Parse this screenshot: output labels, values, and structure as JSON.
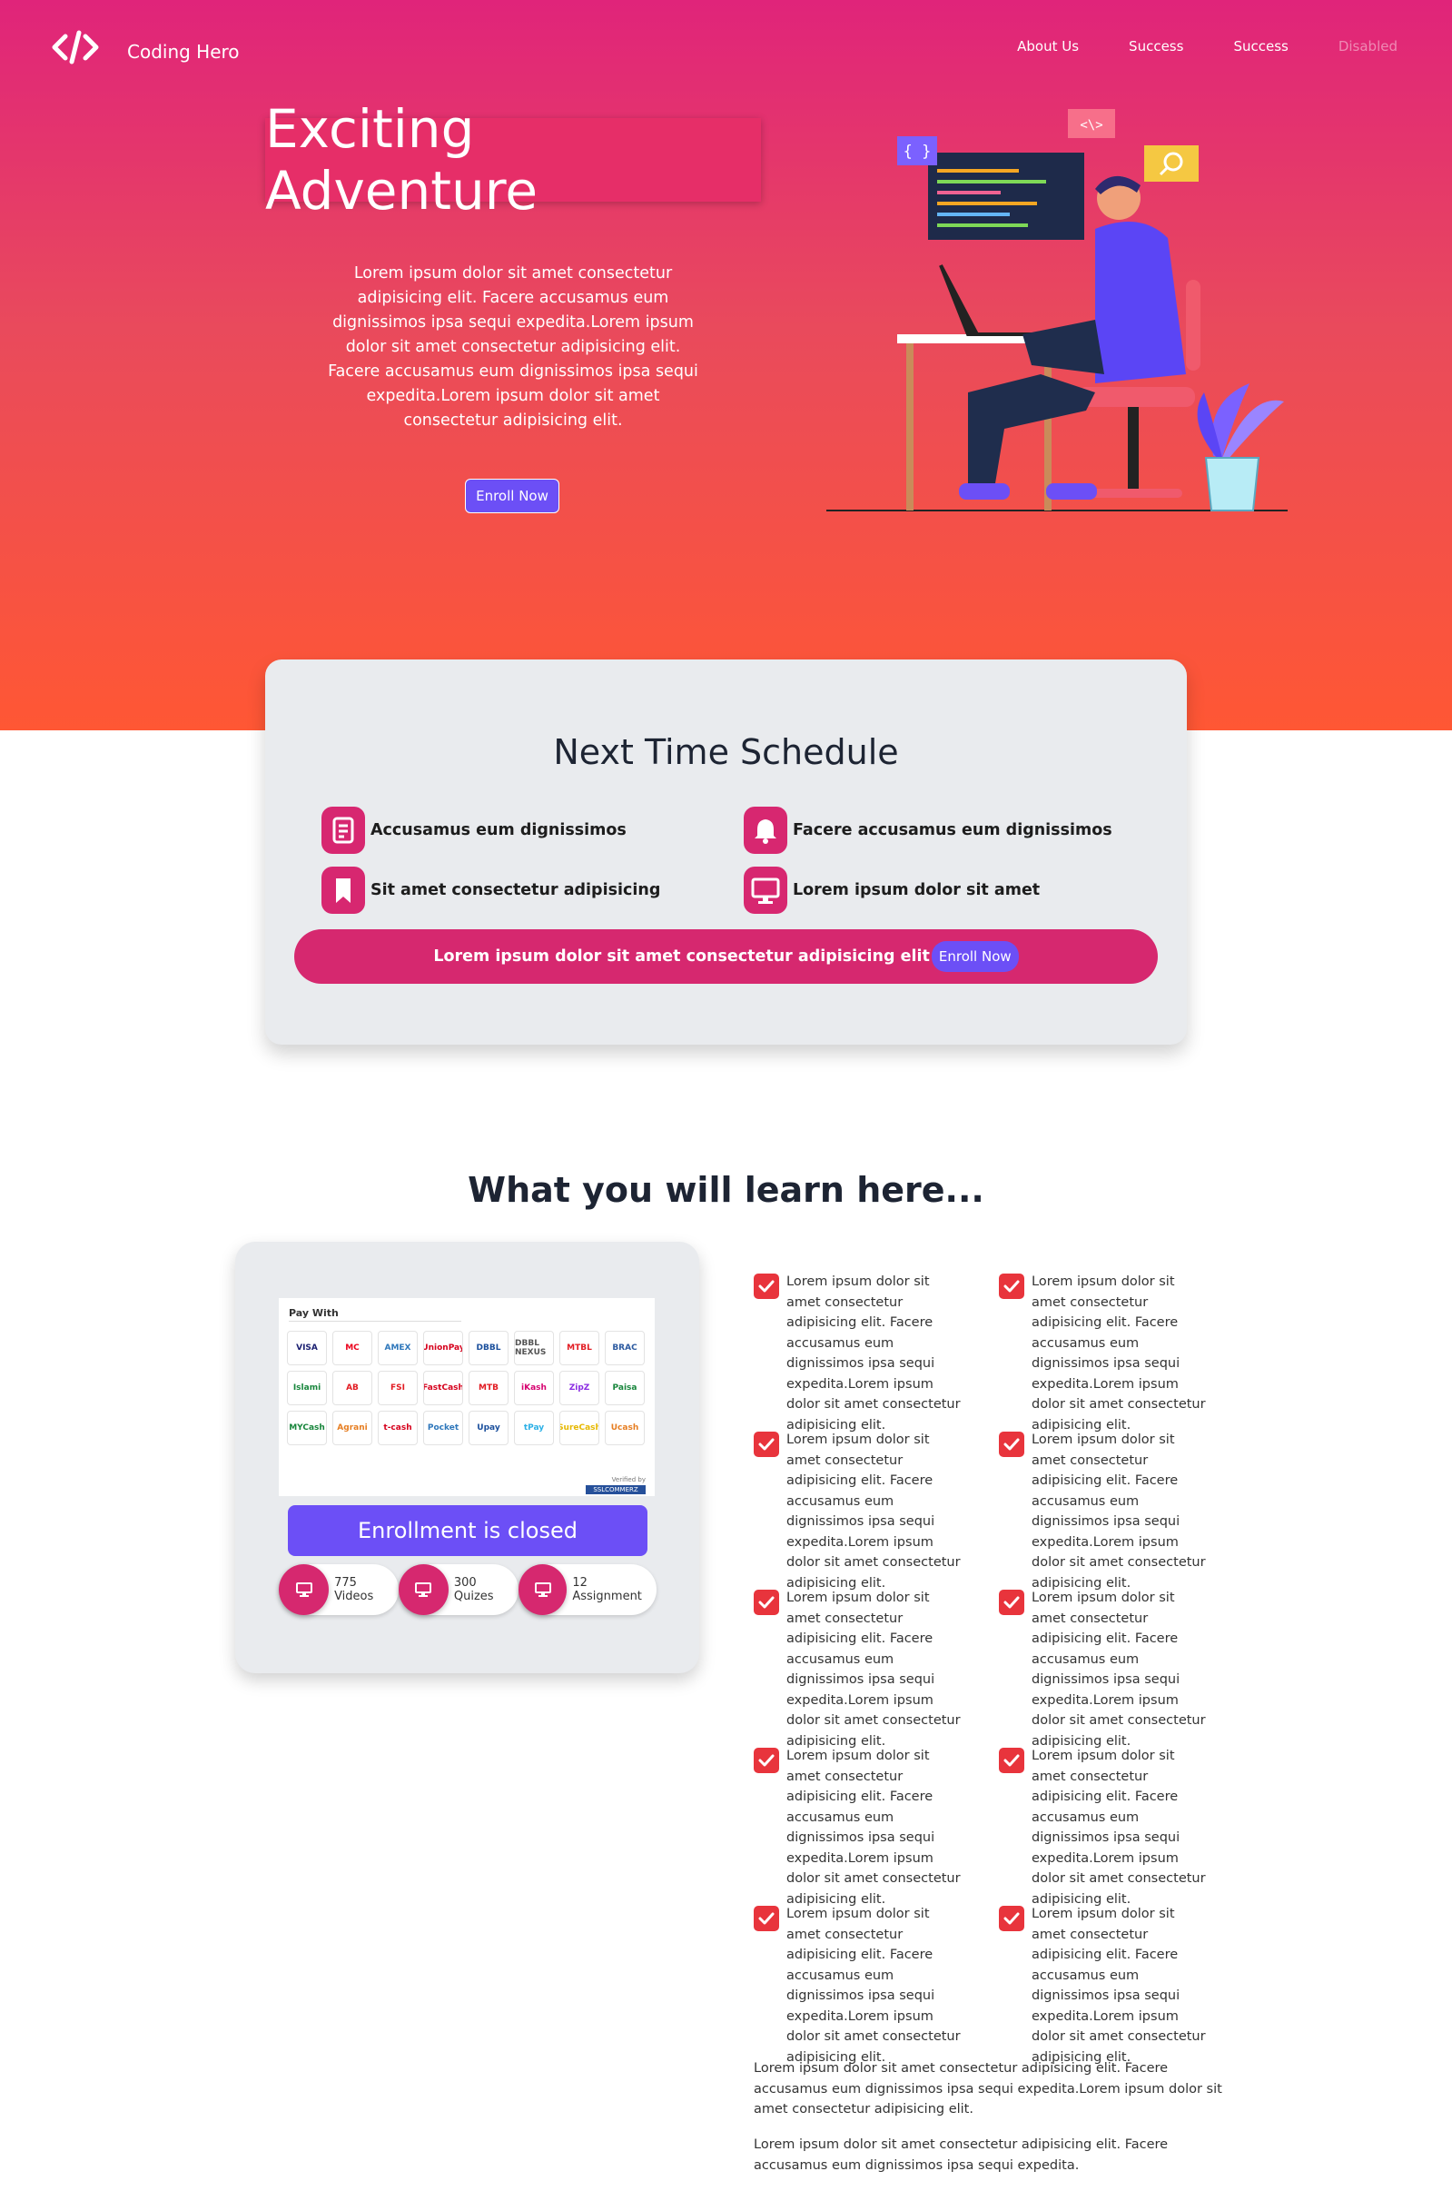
{
  "brand": {
    "name": "Coding Hero"
  },
  "nav": [
    {
      "label": "About Us"
    },
    {
      "label": "Success"
    },
    {
      "label": "Success"
    },
    {
      "label": "Disabled"
    }
  ],
  "hero": {
    "title": "Exciting Adventure",
    "text": "Lorem ipsum dolor sit amet consectetur adipisicing elit. Facere accusamus eum dignissimos ipsa sequi expedita.Lorem ipsum dolor sit amet consectetur adipisicing elit. Facere accusamus eum dignissimos ipsa sequi expedita.Lorem ipsum dolor sit amet consectetur adipisicing elit.",
    "button": "Enroll Now",
    "illustration_tags": [
      "{ }",
      "<\\>"
    ]
  },
  "schedule": {
    "title": "Next Time Schedule",
    "items": [
      {
        "label": "Accusamus eum dignissimos",
        "icon": "document-icon"
      },
      {
        "label": "Facere accusamus eum dignissimos",
        "icon": "bell-icon"
      },
      {
        "label": "Sit amet consectetur adipisicing",
        "icon": "bookmark-icon"
      },
      {
        "label": "Lorem ipsum dolor sit amet",
        "icon": "monitor-icon"
      }
    ],
    "bar_text": "Lorem ipsum dolor sit amet consectetur adipisicing elit",
    "bar_button": "Enroll Now"
  },
  "learn": {
    "title": "What you will learn here...",
    "pay_with": "Pay With",
    "pay_logos": [
      "VISA",
      "MC",
      "AMEX",
      "UnionPay",
      "DBBL",
      "DBBL NEXUS",
      "MTBL",
      "BRAC",
      "Islami",
      "AB",
      "FSI",
      "FastCash",
      "MTB",
      "iKash",
      "ZipZ",
      "Paisa",
      "MYCash",
      "Agrani",
      "t-cash",
      "Pocket",
      "Upay",
      "tPay",
      "SureCash",
      "Ucash"
    ],
    "verified": "Verified by",
    "ssl": "SSLCOMMERZ",
    "enroll_closed": "Enrollment is closed",
    "stats": [
      {
        "label": "775 Videos",
        "icon": "monitor-icon"
      },
      {
        "label": "300 Quizes",
        "icon": "monitor-icon"
      },
      {
        "label": "12 Assignment",
        "icon": "monitor-icon"
      }
    ],
    "check_text": "Lorem ipsum dolor sit amet consectetur adipisicing elit. Facere accusamus eum dignissimos ipsa sequi expedita.Lorem ipsum dolor sit amet consectetur adipisicing elit.",
    "para1": "Lorem ipsum dolor sit amet consectetur adipisicing elit. Facere accusamus eum dignissimos ipsa sequi expedita.Lorem ipsum dolor sit amet consectetur adipisicing elit.",
    "para2": "Lorem ipsum dolor sit amet consectetur adipisicing elit. Facere accusamus eum dignissimos ipsa sequi expedita."
  },
  "colors": {
    "hero_top": "#e0247a",
    "hero_bottom": "#ff5734",
    "accent_purple": "#6c4ff6",
    "accent_pink": "#d6286f",
    "check_red": "#e8343c",
    "card_bg": "#e9ebee"
  }
}
